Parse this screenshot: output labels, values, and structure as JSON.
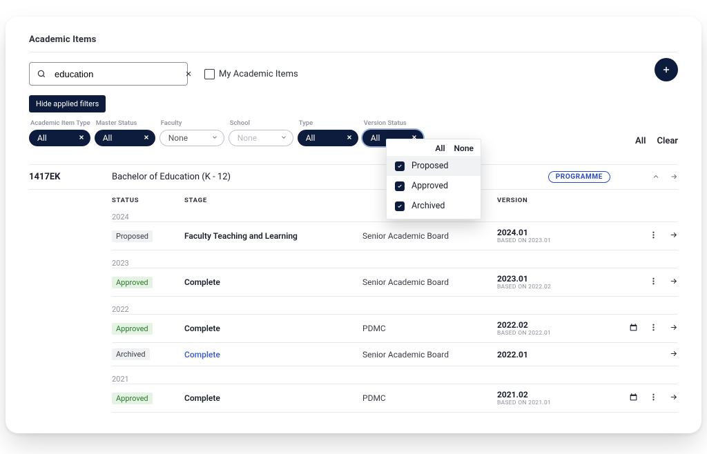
{
  "title": "Academic Items",
  "search": {
    "value": "education"
  },
  "my_items_label": "My Academic Items",
  "hide_filters_label": "Hide applied filters",
  "filters": {
    "academic_item_type": {
      "label": "Academic Item Type",
      "value": "All"
    },
    "master_status": {
      "label": "Master Status",
      "value": "All"
    },
    "faculty": {
      "label": "Faculty",
      "value": "None"
    },
    "school": {
      "label": "School",
      "value": "None"
    },
    "type": {
      "label": "Type",
      "value": "All"
    },
    "version_status": {
      "label": "Version Status",
      "value": "All"
    }
  },
  "filter_actions": {
    "all": "All",
    "clear": "Clear"
  },
  "dropdown": {
    "actions": {
      "all": "All",
      "none": "None"
    },
    "items": [
      {
        "label": "Proposed",
        "checked": true,
        "selected": true
      },
      {
        "label": "Approved",
        "checked": true,
        "selected": false
      },
      {
        "label": "Archived",
        "checked": true,
        "selected": false
      }
    ]
  },
  "result": {
    "code": "1417EK",
    "name": "Bachelor of Education (K - 12)",
    "badge": "PROGRAMME"
  },
  "columns": {
    "status": "STATUS",
    "stage": "STAGE",
    "version": "VERSION"
  },
  "years": [
    {
      "year": "2024",
      "rows": [
        {
          "status": "Proposed",
          "status_style": "neutral",
          "stage": "Faculty Teaching and Learning",
          "stage_link": false,
          "board": "Senior Academic Board",
          "version": "2024.01",
          "based_on": "BASED ON 2023.01",
          "icons": {
            "calendar": false,
            "more": true,
            "arrow": true
          }
        }
      ]
    },
    {
      "year": "2023",
      "rows": [
        {
          "status": "Approved",
          "status_style": "approved",
          "stage": "Complete",
          "stage_link": false,
          "board": "Senior Academic Board",
          "version": "2023.01",
          "based_on": "BASED ON 2022.02",
          "icons": {
            "calendar": false,
            "more": true,
            "arrow": true
          }
        }
      ]
    },
    {
      "year": "2022",
      "rows": [
        {
          "status": "Approved",
          "status_style": "approved",
          "stage": "Complete",
          "stage_link": false,
          "board": "PDMC",
          "version": "2022.02",
          "based_on": "BASED ON 2022.01",
          "icons": {
            "calendar": true,
            "more": true,
            "arrow": true
          }
        },
        {
          "status": "Archived",
          "status_style": "neutral",
          "stage": "Complete",
          "stage_link": true,
          "board": "Senior Academic Board",
          "version": "2022.01",
          "based_on": "",
          "icons": {
            "calendar": false,
            "more": false,
            "arrow": true
          }
        }
      ]
    },
    {
      "year": "2021",
      "rows": [
        {
          "status": "Approved",
          "status_style": "approved",
          "stage": "Complete",
          "stage_link": false,
          "board": "PDMC",
          "version": "2021.02",
          "based_on": "BASED ON 2021.01",
          "icons": {
            "calendar": true,
            "more": true,
            "arrow": true
          }
        }
      ]
    }
  ]
}
